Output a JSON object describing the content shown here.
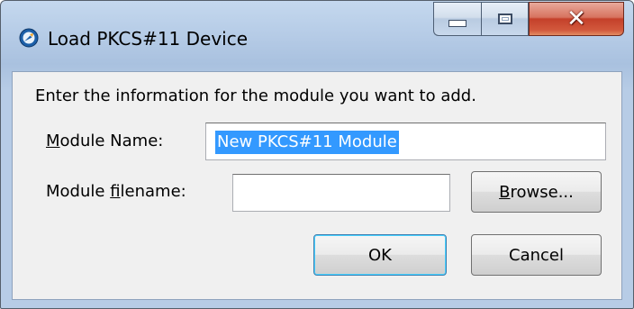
{
  "window": {
    "title": "Load PKCS#11 Device",
    "controls": {
      "minimize": "minimize",
      "maximize": "maximize",
      "close": "close"
    }
  },
  "form": {
    "intro": "Enter the information for the module you want to add.",
    "module_name": {
      "label_prefix": "",
      "label_accel": "M",
      "label_rest": "odule Name:",
      "value": "New PKCS#11 Module"
    },
    "module_filename": {
      "label_prefix": "Module ",
      "label_accel": "f",
      "label_rest": "ilename:",
      "value": ""
    }
  },
  "buttons": {
    "browse": {
      "accel": "B",
      "rest": "rowse..."
    },
    "ok": "OK",
    "cancel": "Cancel"
  },
  "colors": {
    "selection": "#3399ff",
    "close_button": "#c4402a",
    "default_button_border": "#3c7fb1"
  }
}
